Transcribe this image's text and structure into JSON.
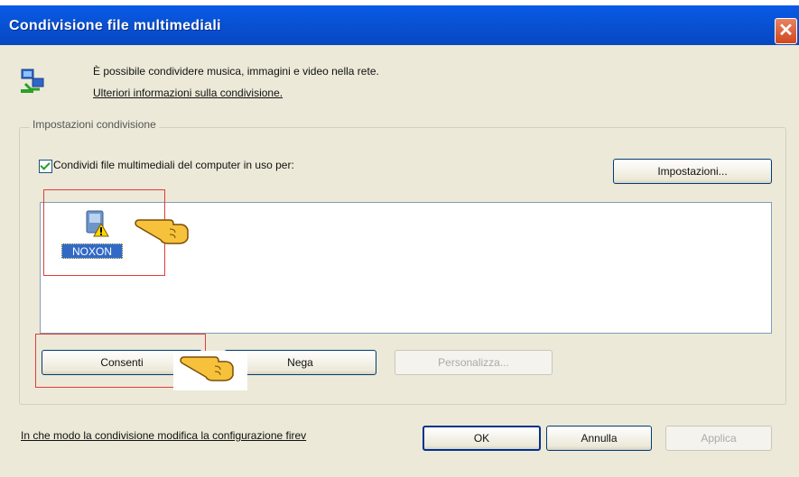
{
  "window": {
    "title": "Condivisione file multimediali",
    "close_glyph": "✕"
  },
  "intro": {
    "text": "È possibile condividere musica, immagini e video nella rete.",
    "link": "Ulteriori informazioni sulla condivisione."
  },
  "group": {
    "label": "Impostazioni condivisione",
    "share_checkbox_label": "Condividi file multimediali del computer in uso per:",
    "share_checked": true,
    "settings_button": "Impostazioni...",
    "devices": [
      {
        "label": "NOXON",
        "icon": "media-device-warning-icon",
        "selected": true
      }
    ],
    "allow_button": "Consenti",
    "deny_button": "Nega",
    "customize_button": "Personalizza..."
  },
  "footer": {
    "firewall_link": "In che modo la condivisione modifica la configurazione firev",
    "ok_button": "OK",
    "cancel_button": "Annulla",
    "apply_button": "Applica"
  },
  "colors": {
    "titlebar": "#0853d6",
    "highlight_box": "#e23b3b",
    "selection": "#316ac5"
  }
}
